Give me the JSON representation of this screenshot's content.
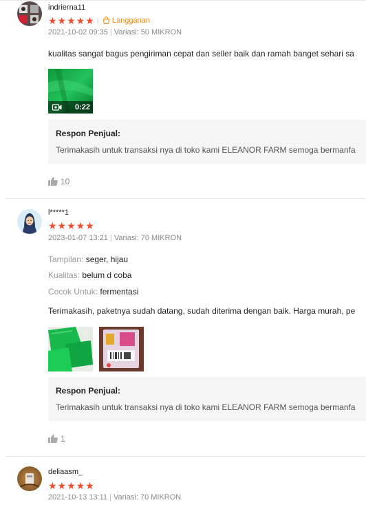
{
  "colors": {
    "accent": "#ee4d2d",
    "badge": "#ee8a1a",
    "media_green": "#14b84a"
  },
  "reviews": [
    {
      "username": "indrierna11",
      "stars": "★★★★★",
      "rating": 5,
      "badge": "Langganan",
      "date": "2021-10-02 09:35",
      "variant": "Variasi: 50 MIKRON",
      "text": "kualitas sangat bagus pengiriman cepat dan seller baik dan ramah banget sehari sa",
      "video_duration": "0:22",
      "response_title": "Respon Penjual:",
      "response_text": "Terimakasih untuk transaksi nya di toko kami ELEANOR FARM semoga bermanfa",
      "likes": "10"
    },
    {
      "username": "l*****1",
      "stars": "★★★★★",
      "rating": 5,
      "date": "2023-01-07 13:21",
      "variant": "Variasi: 70 MIKRON",
      "attributes": [
        {
          "label": "Tampilan:",
          "value": "seger, hijau"
        },
        {
          "label": "Kualitas:",
          "value": "belum d coba"
        },
        {
          "label": "Cocok Untuk:",
          "value": "fermentasi"
        }
      ],
      "text": "Terimakasih, paketnya sudah datang, sudah diterima dengan baik. Harga murah, pe",
      "response_title": "Respon Penjual:",
      "response_text": "Terimakasih untuk transaksi nya di toko kami ELEANOR FARM semoga bermanfa",
      "likes": "1"
    },
    {
      "username": "deliaasm_",
      "stars": "★★★★★",
      "rating": 5,
      "date": "2021-10-13 13:11",
      "variant": "Variasi: 70 MIKRON"
    }
  ]
}
